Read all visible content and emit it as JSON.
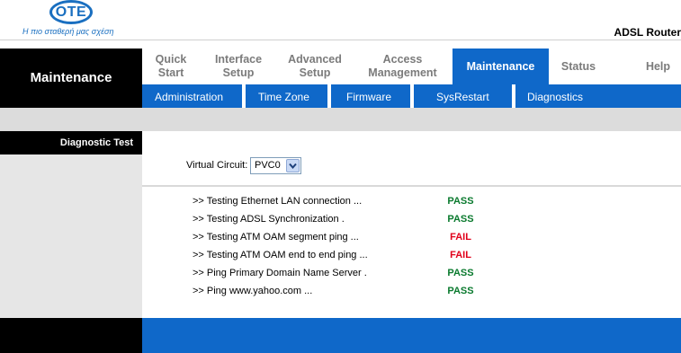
{
  "header": {
    "logo_text": "OTE",
    "tagline": "Η πιο σταθερή μας σχέση",
    "product_name": "ADSL Router",
    "logo_color": "#1a6fc0"
  },
  "section_title": "Maintenance",
  "main_nav": [
    {
      "label": "Quick Start",
      "active": false
    },
    {
      "label": "Interface Setup",
      "active": false
    },
    {
      "label": "Advanced Setup",
      "active": false
    },
    {
      "label": "Access Management",
      "active": false
    },
    {
      "label": "Maintenance",
      "active": true
    },
    {
      "label": "Status",
      "active": false
    },
    {
      "label": "Help",
      "active": false
    }
  ],
  "sub_nav": [
    {
      "label": "Administration"
    },
    {
      "label": "Time Zone"
    },
    {
      "label": "Firmware"
    },
    {
      "label": "SysRestart"
    },
    {
      "label": "Diagnostics"
    }
  ],
  "side_menu": {
    "label": "Diagnostic Test"
  },
  "virtual_circuit": {
    "label": "Virtual Circuit:",
    "value": "PVC0",
    "arrow_icon": "chevron-down-icon"
  },
  "tests": [
    {
      "label": ">> Testing Ethernet LAN connection ...",
      "status": "PASS"
    },
    {
      "label": ">> Testing ADSL Synchronization .",
      "status": "PASS"
    },
    {
      "label": ">> Testing ATM OAM segment ping ...",
      "status": "FAIL"
    },
    {
      "label": ">> Testing ATM OAM end to end ping ...",
      "status": "FAIL"
    },
    {
      "label": ">> Ping Primary Domain Name Server .",
      "status": "PASS"
    },
    {
      "label": ">> Ping www.yahoo.com ...",
      "status": "PASS"
    }
  ],
  "colors": {
    "accent_blue": "#0f68c9",
    "pass": "#0a7a2e",
    "fail": "#e1001a",
    "nav_inactive": "#7b7b7b"
  }
}
